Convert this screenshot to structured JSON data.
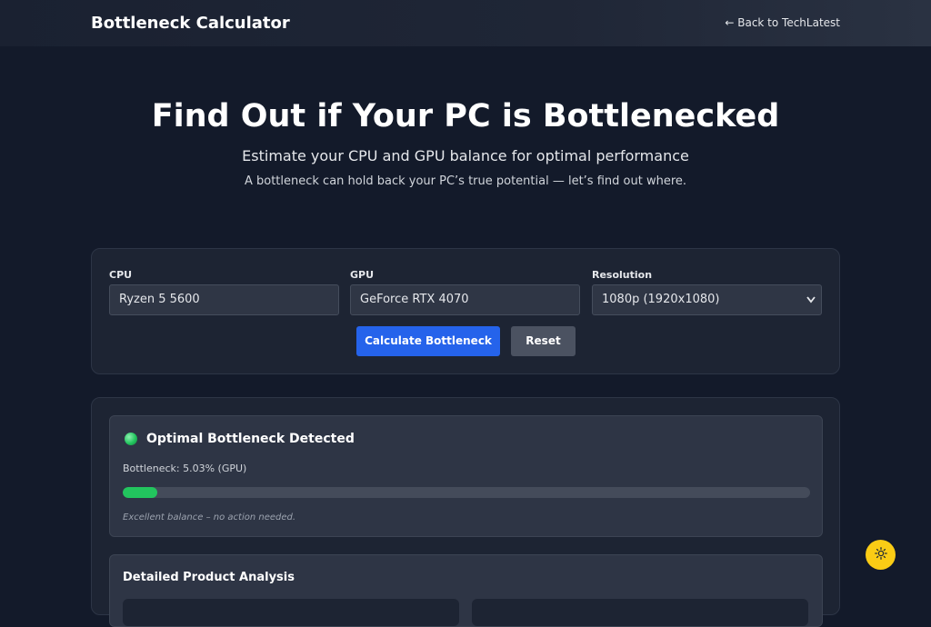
{
  "header": {
    "brand": "Bottleneck Calculator",
    "back_link": "← Back to TechLatest"
  },
  "hero": {
    "title": "Find Out if Your PC is Bottlenecked",
    "subtitle": "Estimate your CPU and GPU balance for optimal performance",
    "description": "A bottleneck can hold back your PC’s true potential — let’s find out where."
  },
  "form": {
    "cpu_label": "CPU",
    "cpu_value": "Ryzen 5 5600",
    "gpu_label": "GPU",
    "gpu_value": "GeForce RTX 4070",
    "resolution_label": "Resolution",
    "resolution_value": "1080p (1920x1080)",
    "calculate_label": "Calculate Bottleneck",
    "reset_label": "Reset"
  },
  "result": {
    "status": "Optimal Bottleneck Detected",
    "bottleneck_text": "Bottleneck: 5.03% (GPU)",
    "bottleneck_percent": 5.03,
    "advice": "Excellent balance – no action needed.",
    "status_color": "#22c55e"
  },
  "details": {
    "title": "Detailed Product Analysis"
  },
  "theme": {
    "toggle_icon": "sun-icon",
    "toggle_color": "#facc15"
  }
}
